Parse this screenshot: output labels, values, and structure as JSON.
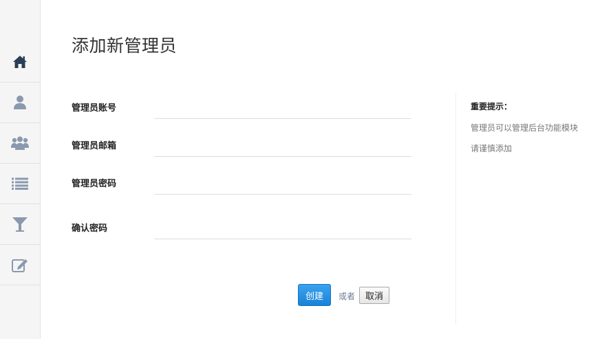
{
  "sidebar": {
    "items": [
      {
        "icon": "home-icon"
      },
      {
        "icon": "user-icon"
      },
      {
        "icon": "users-group-icon"
      },
      {
        "icon": "list-icon"
      },
      {
        "icon": "filter-icon"
      },
      {
        "icon": "edit-icon"
      }
    ],
    "active_color": "#2c3e55",
    "icon_color": "#8a99ad"
  },
  "main": {
    "title": "添加新管理员",
    "form": {
      "fields": [
        {
          "label": "管理员账号",
          "value": ""
        },
        {
          "label": "管理员邮箱",
          "value": ""
        },
        {
          "label": "管理员密码",
          "value": ""
        },
        {
          "label": "确认密码",
          "value": ""
        }
      ],
      "create_label": "创建",
      "or_label": "或者",
      "cancel_label": "取消"
    }
  },
  "tips": {
    "title": "重要提示：",
    "lines": [
      "管理员可以管理后台功能模块",
      "请谨慎添加"
    ]
  }
}
